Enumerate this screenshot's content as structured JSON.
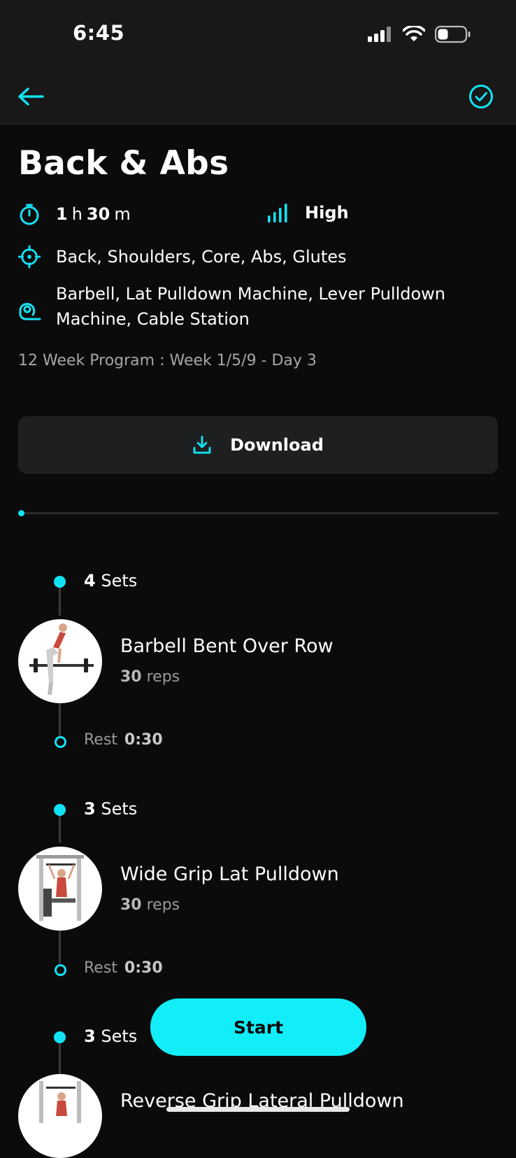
{
  "status": {
    "time": "6:45"
  },
  "nav": {
    "back_icon": "arrow-left-icon",
    "done_icon": "check-circle-icon"
  },
  "workout": {
    "title": "Back & Abs",
    "duration": {
      "hours": "1",
      "h": "h",
      "minutes": "30",
      "m": "m"
    },
    "intensity": "High",
    "muscles": "Back, Shoulders, Core, Abs, Glutes",
    "equipment": "Barbell, Lat Pulldown Machine, Lever Pulldown Machine, Cable Station",
    "program": "12 Week Program : Week 1/5/9 - Day 3"
  },
  "download_label": "Download",
  "progress": 0.0,
  "exercises": [
    {
      "sets": "4",
      "sets_word": "Sets",
      "name": "Barbell Bent Over Row",
      "reps": "30",
      "reps_word": "reps",
      "rest_word": "Rest",
      "rest": "0:30"
    },
    {
      "sets": "3",
      "sets_word": "Sets",
      "name": "Wide Grip Lat Pulldown",
      "reps": "30",
      "reps_word": "reps",
      "rest_word": "Rest",
      "rest": "0:30"
    },
    {
      "sets": "3",
      "sets_word": "Sets",
      "name": "Reverse Grip Lateral Pulldown"
    }
  ],
  "start_label": "Start",
  "colors": {
    "accent": "#12e3f4",
    "background": "#0b0b0c",
    "button": "#12eef8"
  }
}
